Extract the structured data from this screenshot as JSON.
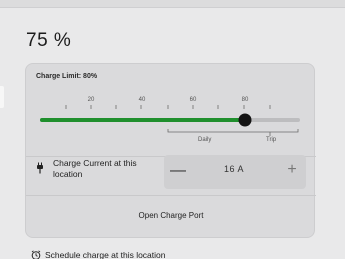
{
  "status": {
    "battery_percent": "75 %"
  },
  "charge_limit": {
    "label": "Charge Limit: 80%",
    "value": 80,
    "scale_labels": [
      "20",
      "40",
      "60",
      "80"
    ],
    "daily_label": "Daily",
    "trip_label": "Trip",
    "fill_color": "#1f8f2d",
    "track_color": "#bdbdbf"
  },
  "charge_current": {
    "label": "Charge Current at this location",
    "value": "16 A",
    "minus_symbol": "—",
    "plus_symbol": "+"
  },
  "open_charge_port": {
    "label": "Open Charge Port"
  },
  "schedule": {
    "label": "Schedule charge at this location"
  }
}
